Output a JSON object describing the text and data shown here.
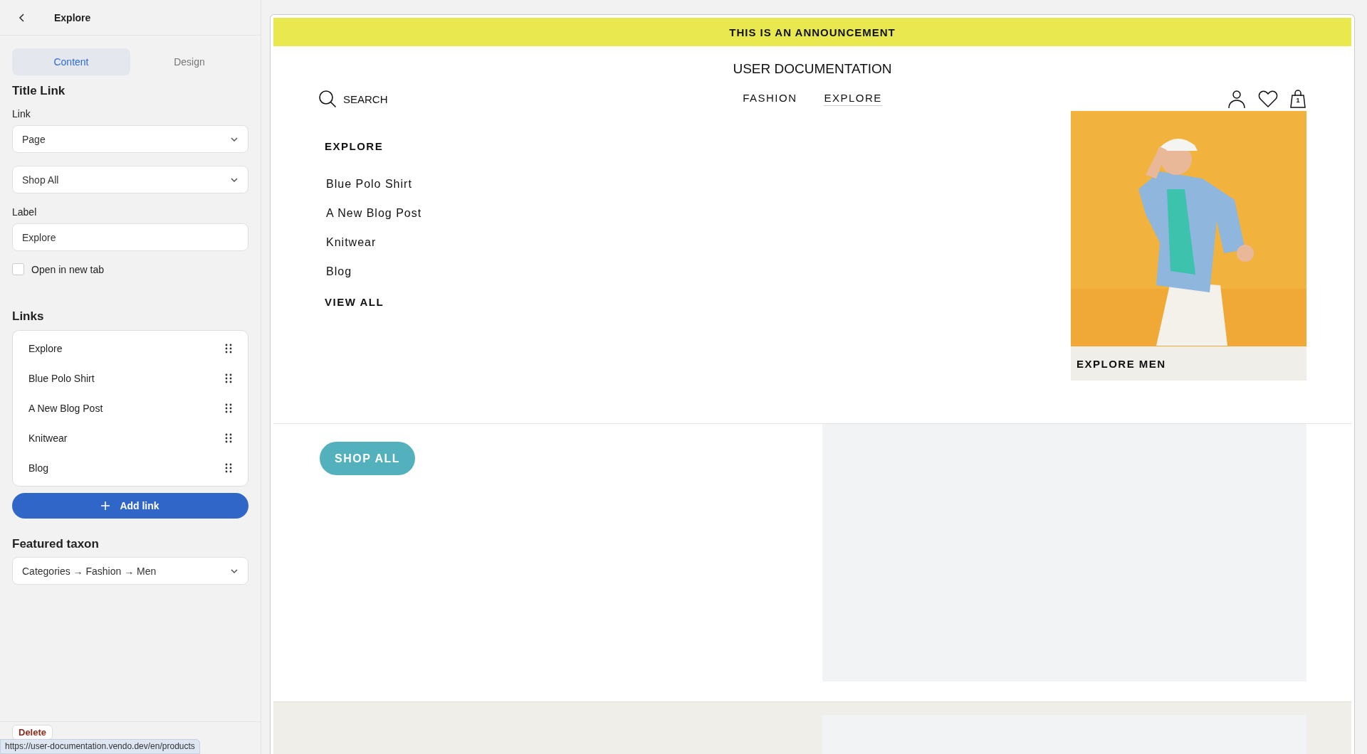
{
  "sidebar": {
    "title": "Explore",
    "tabs": [
      {
        "label": "Content",
        "selected": true
      },
      {
        "label": "Design",
        "selected": false
      }
    ],
    "section_title": "Title Link",
    "link_label": "Link",
    "link_type": "Page",
    "link_target": "Shop All",
    "label_label": "Label",
    "label_value": "Explore",
    "open_in_new_tab": {
      "label": "Open in new tab",
      "checked": false
    },
    "links_title": "Links",
    "links": [
      "Explore",
      "Blue Polo Shirt",
      "A New Blog Post",
      "Knitwear",
      "Blog"
    ],
    "add_link": "Add link",
    "featured_title": "Featured taxon",
    "featured_value": "Categories → Fashion → Men",
    "delete": "Delete"
  },
  "status_url": "https://user-documentation.vendo.dev/en/products",
  "preview": {
    "announcement": "THIS IS AN ANNOUNCEMENT",
    "logo": "USER DOCUMENTATION",
    "search": "SEARCH",
    "nav": [
      {
        "label": "FASHION",
        "selected": false
      },
      {
        "label": "EXPLORE",
        "selected": true
      }
    ],
    "cart_count": "1",
    "menu": {
      "heading": "EXPLORE",
      "items": [
        "Blue Polo Shirt",
        "A New Blog Post",
        "Knitwear",
        "Blog"
      ],
      "view_all": "VIEW ALL",
      "featured": {
        "kind": "picture",
        "caption": "EXPLORE MEN"
      }
    },
    "cta": "SHOP ALL"
  }
}
